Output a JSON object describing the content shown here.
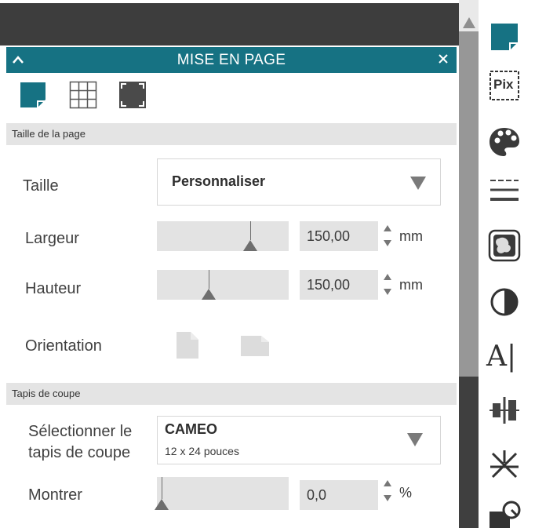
{
  "window": {
    "title": "MISE EN PAGE",
    "collapse_icon": "chevron-up-icon",
    "close_icon": "close-icon"
  },
  "modes": [
    {
      "name": "page-setup-icon",
      "active": true
    },
    {
      "name": "grid-icon",
      "active": false
    },
    {
      "name": "registration-marks-icon",
      "active": false
    }
  ],
  "page_size_section": {
    "title": "Taille de la page",
    "size": {
      "label": "Taille",
      "value": "Personnaliser"
    },
    "width": {
      "label": "Largeur",
      "value": "150,00",
      "unit": "mm",
      "slider_fraction": 0.7
    },
    "height": {
      "label": "Hauteur",
      "value": "150,00",
      "unit": "mm",
      "slider_fraction": 0.4
    },
    "orientation": {
      "label": "Orientation",
      "options": [
        "portrait",
        "landscape"
      ]
    }
  },
  "cutting_mat_section": {
    "title": "Tapis de coupe",
    "mat": {
      "label_line1": "Sélectionner le",
      "label_line2": "tapis de coupe",
      "value": "CAMEO",
      "subvalue": "12 x 24 pouces"
    },
    "show": {
      "label": "Montrer",
      "value": "0,0",
      "unit": "%",
      "slider_fraction": 0.02
    }
  },
  "toolbar": {
    "items": [
      "page-setup-icon",
      "pixscan-icon",
      "fill-palette-icon",
      "line-style-icon",
      "image-trace-icon",
      "contrast-icon",
      "text-style-icon",
      "align-icon",
      "replicate-icon",
      "send-icon"
    ],
    "pixscan_text": "Pix",
    "text_style_text": "A|"
  },
  "colors": {
    "accent": "#167283",
    "header_bg": "#3d3d3d",
    "section_bg": "#e4e4e4",
    "field_bg": "#e3e3e3"
  }
}
